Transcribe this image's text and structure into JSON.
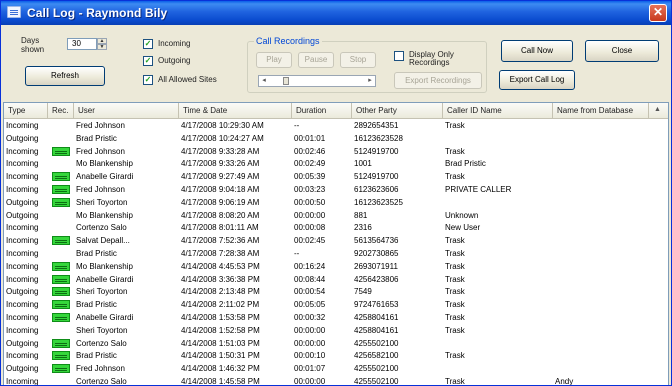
{
  "window": {
    "title": "Call Log - Raymond Bily",
    "close_glyph": "✕"
  },
  "toolbar": {
    "days_shown_label": "Days\nshown",
    "days_shown_value": "30",
    "refresh_label": "Refresh",
    "checkboxes": [
      {
        "label": "Incoming",
        "checked": true
      },
      {
        "label": "Outgoing",
        "checked": true
      },
      {
        "label": "All Allowed Sites",
        "checked": true
      }
    ],
    "recordings_group": "Call Recordings",
    "rec_buttons": [
      "Play",
      "Pause",
      "Stop"
    ],
    "export_recordings_label": "Export Recordings",
    "display_only_label": "Display Only Recordings",
    "call_now_label": "Call Now",
    "close_label": "Close",
    "export_call_log_label": "Export Call Log"
  },
  "grid": {
    "headers": [
      "Type",
      "Rec.",
      "User",
      "Time & Date",
      "Duration",
      "Other Party",
      "Caller ID Name",
      "Name from Database"
    ],
    "rows": [
      [
        "Incoming",
        false,
        "Fred Johnson",
        "4/17/2008 10:29:30 AM",
        "--",
        "2892654351",
        "Trask",
        ""
      ],
      [
        "Outgoing",
        false,
        "Brad Pristic",
        "4/17/2008 10:24:27 AM",
        "00:01:01",
        "16123623528",
        "",
        ""
      ],
      [
        "Incoming",
        true,
        "Fred Johnson",
        "4/17/2008 9:33:28 AM",
        "00:02:46",
        "5124919700",
        "Trask",
        ""
      ],
      [
        "Incoming",
        false,
        "Mo Blankenship",
        "4/17/2008 9:33:26 AM",
        "00:02:49",
        "1001",
        "Brad Pristic",
        ""
      ],
      [
        "Incoming",
        true,
        "Anabelle Girardi",
        "4/17/2008 9:27:49 AM",
        "00:05:39",
        "5124919700",
        "Trask",
        ""
      ],
      [
        "Incoming",
        true,
        "Fred Johnson",
        "4/17/2008 9:04:18 AM",
        "00:03:23",
        "6123623606",
        "PRIVATE CALLER",
        ""
      ],
      [
        "Outgoing",
        true,
        "Sheri Toyorton",
        "4/17/2008 9:06:19 AM",
        "00:00:50",
        "16123623525",
        "",
        ""
      ],
      [
        "Outgoing",
        false,
        "Mo Blankenship",
        "4/17/2008 8:08:20 AM",
        "00:00:00",
        "881",
        "Unknown",
        ""
      ],
      [
        "Incoming",
        false,
        "Cortenzo Salo",
        "4/17/2008 8:01:11 AM",
        "00:00:08",
        "2316",
        "New User",
        ""
      ],
      [
        "Incoming",
        true,
        "Salvat Depall...",
        "4/17/2008 7:52:36 AM",
        "00:02:45",
        "5613564736",
        "Trask",
        ""
      ],
      [
        "Incoming",
        false,
        "Brad Pristic",
        "4/17/2008 7:28:38 AM",
        "--",
        "9202730865",
        "Trask",
        ""
      ],
      [
        "Incoming",
        true,
        "Mo Blankenship",
        "4/14/2008 4:45:53 PM",
        "00:16:24",
        "2693071911",
        "Trask",
        ""
      ],
      [
        "Incoming",
        true,
        "Anabelle Girardi",
        "4/14/2008 3:36:38 PM",
        "00:08:44",
        "4256423806",
        "Trask",
        ""
      ],
      [
        "Outgoing",
        true,
        "Sheri Toyorton",
        "4/14/2008 2:13:48 PM",
        "00:00:54",
        "7549",
        "Trask",
        ""
      ],
      [
        "Incoming",
        true,
        "Brad Pristic",
        "4/14/2008 2:11:02 PM",
        "00:05:05",
        "9724761653",
        "Trask",
        ""
      ],
      [
        "Incoming",
        true,
        "Anabelle Girardi",
        "4/14/2008 1:53:58 PM",
        "00:00:32",
        "4258804161",
        "Trask",
        ""
      ],
      [
        "Incoming",
        false,
        "Sheri Toyorton",
        "4/14/2008 1:52:58 PM",
        "00:00:00",
        "4258804161",
        "Trask",
        ""
      ],
      [
        "Outgoing",
        true,
        "Cortenzo Salo",
        "4/14/2008 1:51:03 PM",
        "00:00:00",
        "4255502100",
        "",
        ""
      ],
      [
        "Incoming",
        true,
        "Brad Pristic",
        "4/14/2008 1:50:31 PM",
        "00:00:10",
        "4256582100",
        "Trask",
        ""
      ],
      [
        "Outgoing",
        true,
        "Fred Johnson",
        "4/14/2008 1:46:32 PM",
        "00:01:07",
        "4255502100",
        "",
        ""
      ],
      [
        "Incoming",
        false,
        "Cortenzo Salo",
        "4/14/2008 1:45:58 PM",
        "00:00:00",
        "4255502100",
        "Trask",
        "Andy"
      ]
    ]
  },
  "colors": {
    "title_bar": "#0a4bcf",
    "rec_icon": "#35d63b",
    "group_title": "#0046d5"
  }
}
